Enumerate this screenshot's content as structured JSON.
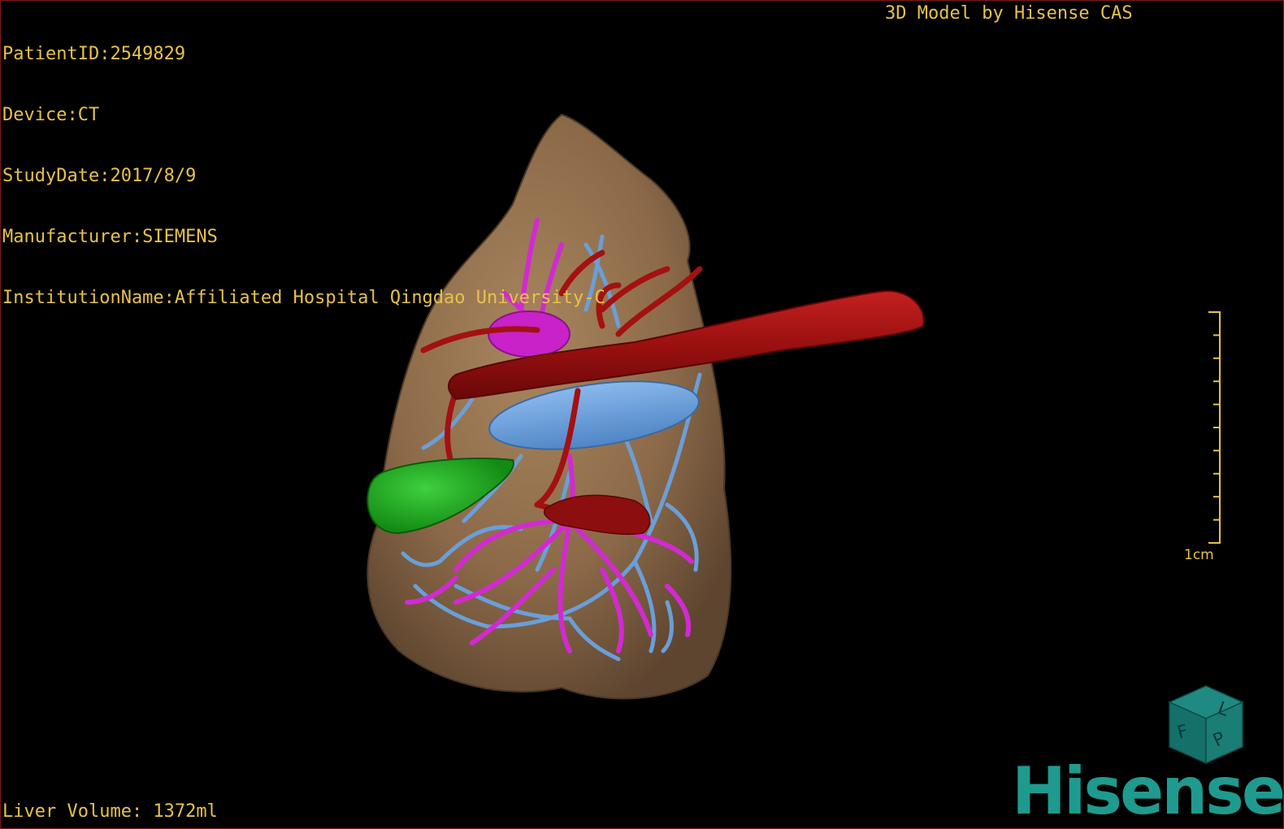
{
  "patient_info": {
    "patient_id": "PatientID:2549829",
    "device": "Device:CT",
    "study_date": "StudyDate:2017/8/9",
    "manufacturer": "Manufacturer:SIEMENS",
    "institution": "InstitutionName:Affiliated Hospital Qingdao University-C"
  },
  "watermark_title": "3D Model by Hisense CAS",
  "liver_volume": "Liver Volume: 1372ml",
  "scale": {
    "label": "1cm",
    "tick_count": 10
  },
  "orientation_cube": {
    "face_labels": [
      "F",
      "L",
      "P"
    ],
    "icon": "orientation-cube-icon"
  },
  "brand": "Hisense",
  "colors": {
    "text": "#e8c24a",
    "liver": "#8c6a49",
    "artery": "#a31111",
    "portal_vein": "#d22ad2",
    "hepatic_vein": "#6a9fd8",
    "gallbladder": "#1fa31f",
    "brand": "#1f9a8e"
  }
}
